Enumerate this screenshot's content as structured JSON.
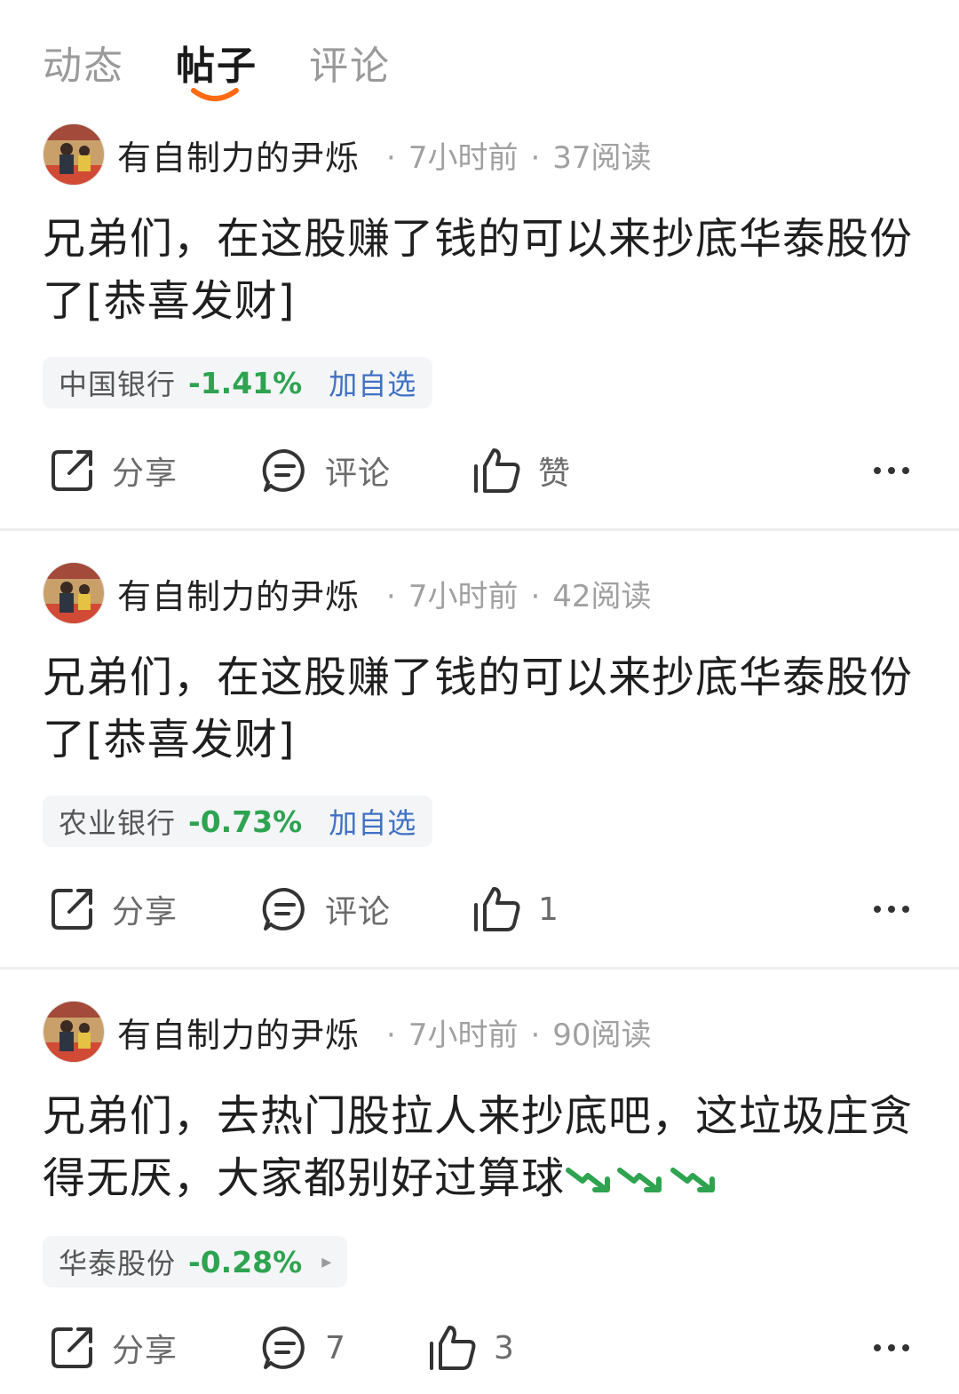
{
  "tabs": [
    {
      "label": "动态"
    },
    {
      "label": "帖子"
    },
    {
      "label": "评论"
    }
  ],
  "colors": {
    "accent": "#ff6a13",
    "down": "#2ea350",
    "link": "#3f71c4"
  },
  "posts": [
    {
      "author": "有自制力的尹烁",
      "time": "7小时前",
      "reads": "37阅读",
      "content": "兄弟们，在这股赚了钱的可以来抄底华泰股份了[恭喜发财]",
      "stock": {
        "name": "中国银行",
        "change": "-1.41%",
        "add_label": "加自选"
      },
      "share_label": "分享",
      "comment_label": "评论",
      "like_label": "赞"
    },
    {
      "author": "有自制力的尹烁",
      "time": "7小时前",
      "reads": "42阅读",
      "content": "兄弟们，在这股赚了钱的可以来抄底华泰股份了[恭喜发财]",
      "stock": {
        "name": "农业银行",
        "change": "-0.73%",
        "add_label": "加自选"
      },
      "share_label": "分享",
      "comment_label": "评论",
      "like_label": "1"
    },
    {
      "author": "有自制力的尹烁",
      "time": "7小时前",
      "reads": "90阅读",
      "content": "兄弟们，去热门股拉人来抄底吧，这垃圾庄贪得无厌，大家都别好过算球",
      "content_trend_icons": 3,
      "stock": {
        "name": "华泰股份",
        "change": "-0.28%",
        "arrow": "▸"
      },
      "share_label": "分享",
      "comment_label": "7",
      "like_label": "3"
    }
  ],
  "icons": {
    "share": "share-icon",
    "comment": "comment-icon",
    "like": "thumbs-up-icon",
    "more": "more-icon",
    "trend": "trend-down-icon"
  }
}
